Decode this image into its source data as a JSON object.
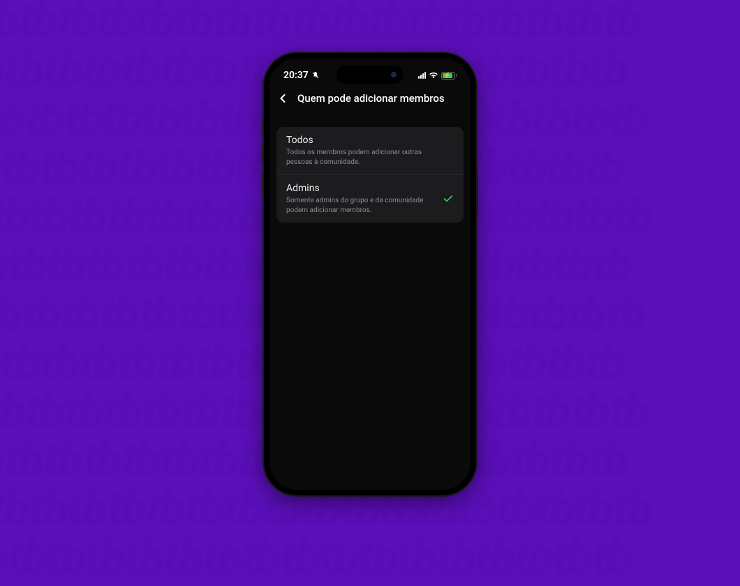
{
  "status_bar": {
    "time": "20:37"
  },
  "header": {
    "title": "Quem pode adicionar membros"
  },
  "options": [
    {
      "title": "Todos",
      "description": "Todos os membros podem adicionar outras pessoas à comunidade.",
      "selected": false
    },
    {
      "title": "Admins",
      "description": "Somente admins do grupo e da comunidade podem adicionar membros.",
      "selected": true
    }
  ],
  "bg_pattern_text": "tbtbtbtbtbtbtbtbtbtbtbtbtbtbtbtbtb"
}
